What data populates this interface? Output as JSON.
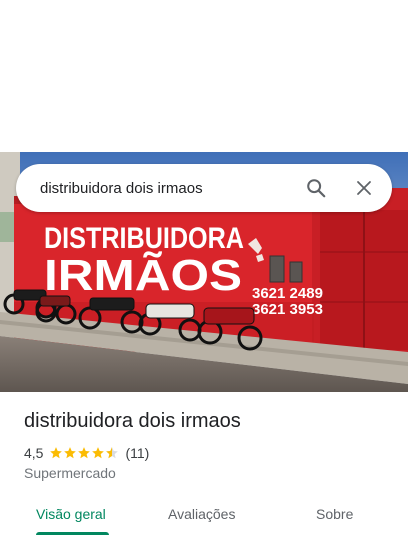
{
  "search": {
    "query": "distribuidora dois irmaos"
  },
  "photo": {
    "sign_line1": "DISTRIBUIDORA",
    "sign_line2": "IRMÃOS",
    "phone1": "3621 2489",
    "phone2": "3621 3953"
  },
  "place": {
    "title": "distribuidora dois irmaos",
    "rating": "4,5",
    "stars": 4.5,
    "review_count": "(11)",
    "category": "Supermercado"
  },
  "tabs": [
    {
      "label": "Visão geral",
      "active": true
    },
    {
      "label": "Avaliações",
      "active": false
    },
    {
      "label": "Sobre",
      "active": false
    }
  ],
  "colors": {
    "accent": "#01875f",
    "star": "#fbbc04",
    "wall_red": "#d9252b"
  },
  "icons": {
    "search": "search-icon",
    "clear": "close-icon"
  }
}
